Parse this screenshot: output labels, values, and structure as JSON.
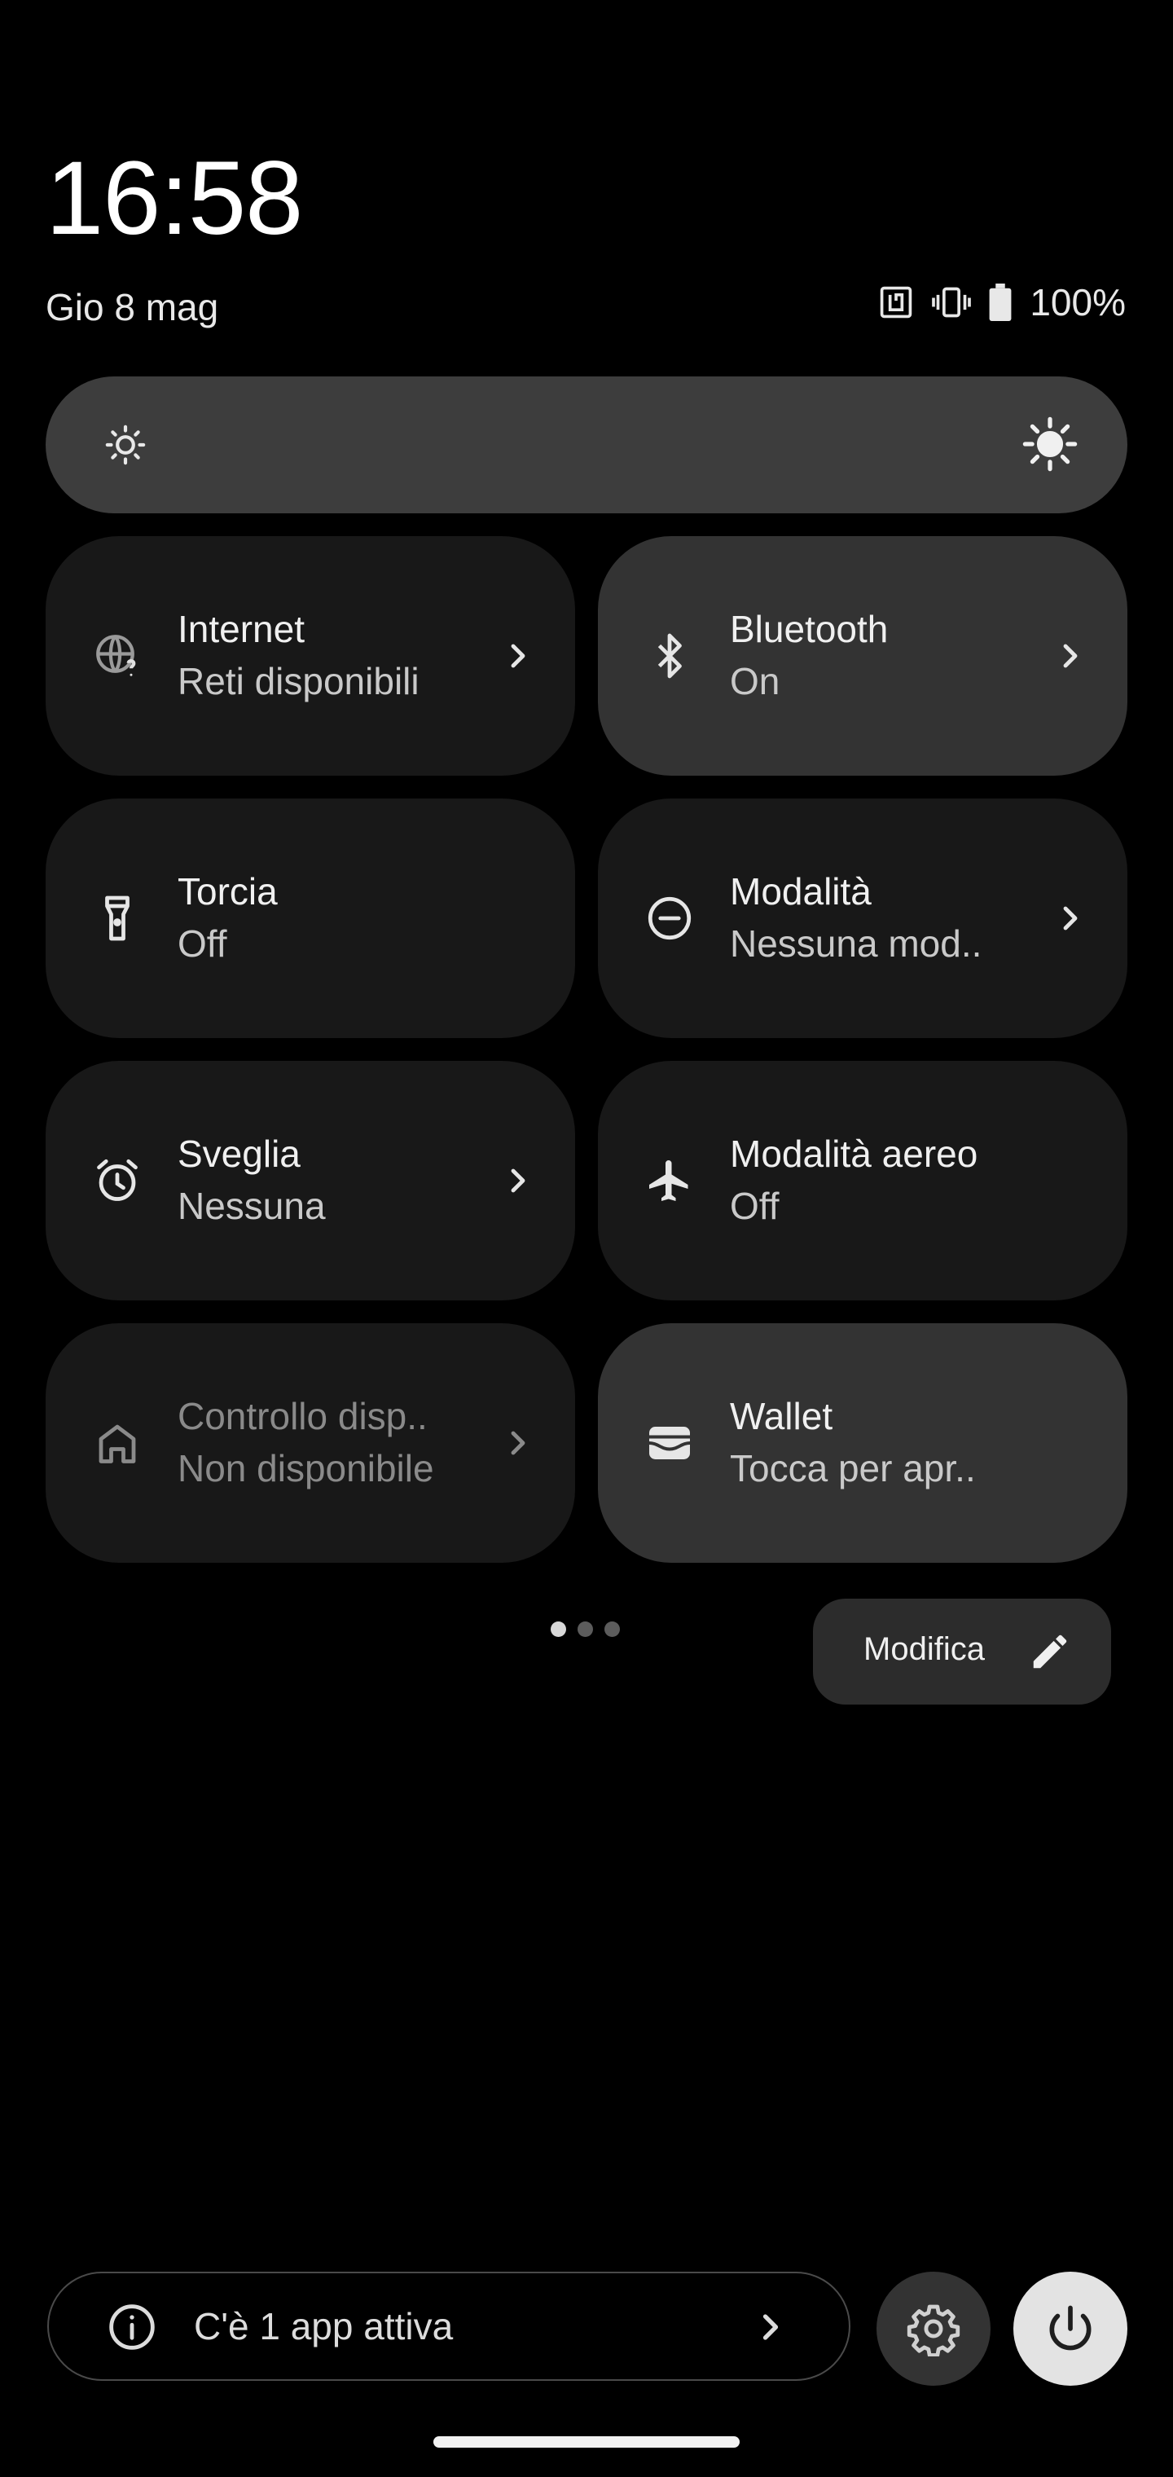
{
  "header": {
    "time": "16:58",
    "date": "Gio 8 mag",
    "battery": "100%",
    "status_icons": [
      "nfc-icon",
      "vibrate-icon",
      "battery-icon"
    ]
  },
  "brightness": {
    "low_icon": "brightness-low-icon",
    "high_icon": "brightness-high-icon"
  },
  "tiles": [
    {
      "title": "Internet",
      "subtitle": "Reti disponibili",
      "icon": "globe-question-icon",
      "active": false,
      "chevron": true
    },
    {
      "title": "Bluetooth",
      "subtitle": "On",
      "icon": "bluetooth-icon",
      "active": true,
      "chevron": true
    },
    {
      "title": "Torcia",
      "subtitle": "Off",
      "icon": "flashlight-icon",
      "active": false,
      "chevron": false
    },
    {
      "title": "Modalità",
      "subtitle": "Nessuna mod..",
      "icon": "do-not-disturb-icon",
      "active": false,
      "chevron": true
    },
    {
      "title": "Sveglia",
      "subtitle": "Nessuna",
      "icon": "alarm-icon",
      "active": false,
      "chevron": true
    },
    {
      "title": "Modalità aereo",
      "subtitle": "Off",
      "icon": "airplane-icon",
      "active": false,
      "chevron": false
    },
    {
      "title": "Controllo disp..",
      "subtitle": "Non disponibile",
      "icon": "home-icon",
      "active": false,
      "chevron": true
    },
    {
      "title": "Wallet",
      "subtitle": "Tocca per apr..",
      "icon": "wallet-icon",
      "active": true,
      "chevron": false
    }
  ],
  "pager": {
    "pages": 3,
    "current": 1
  },
  "edit": {
    "label": "Modifica"
  },
  "footer": {
    "active_apps": "C'è 1 app attiva"
  },
  "colors": {
    "background": "#000000",
    "tile": "#181818",
    "tile_active": "#333333",
    "brightness_track": "#3d3d3d",
    "power_button": "#e3e3e3"
  }
}
